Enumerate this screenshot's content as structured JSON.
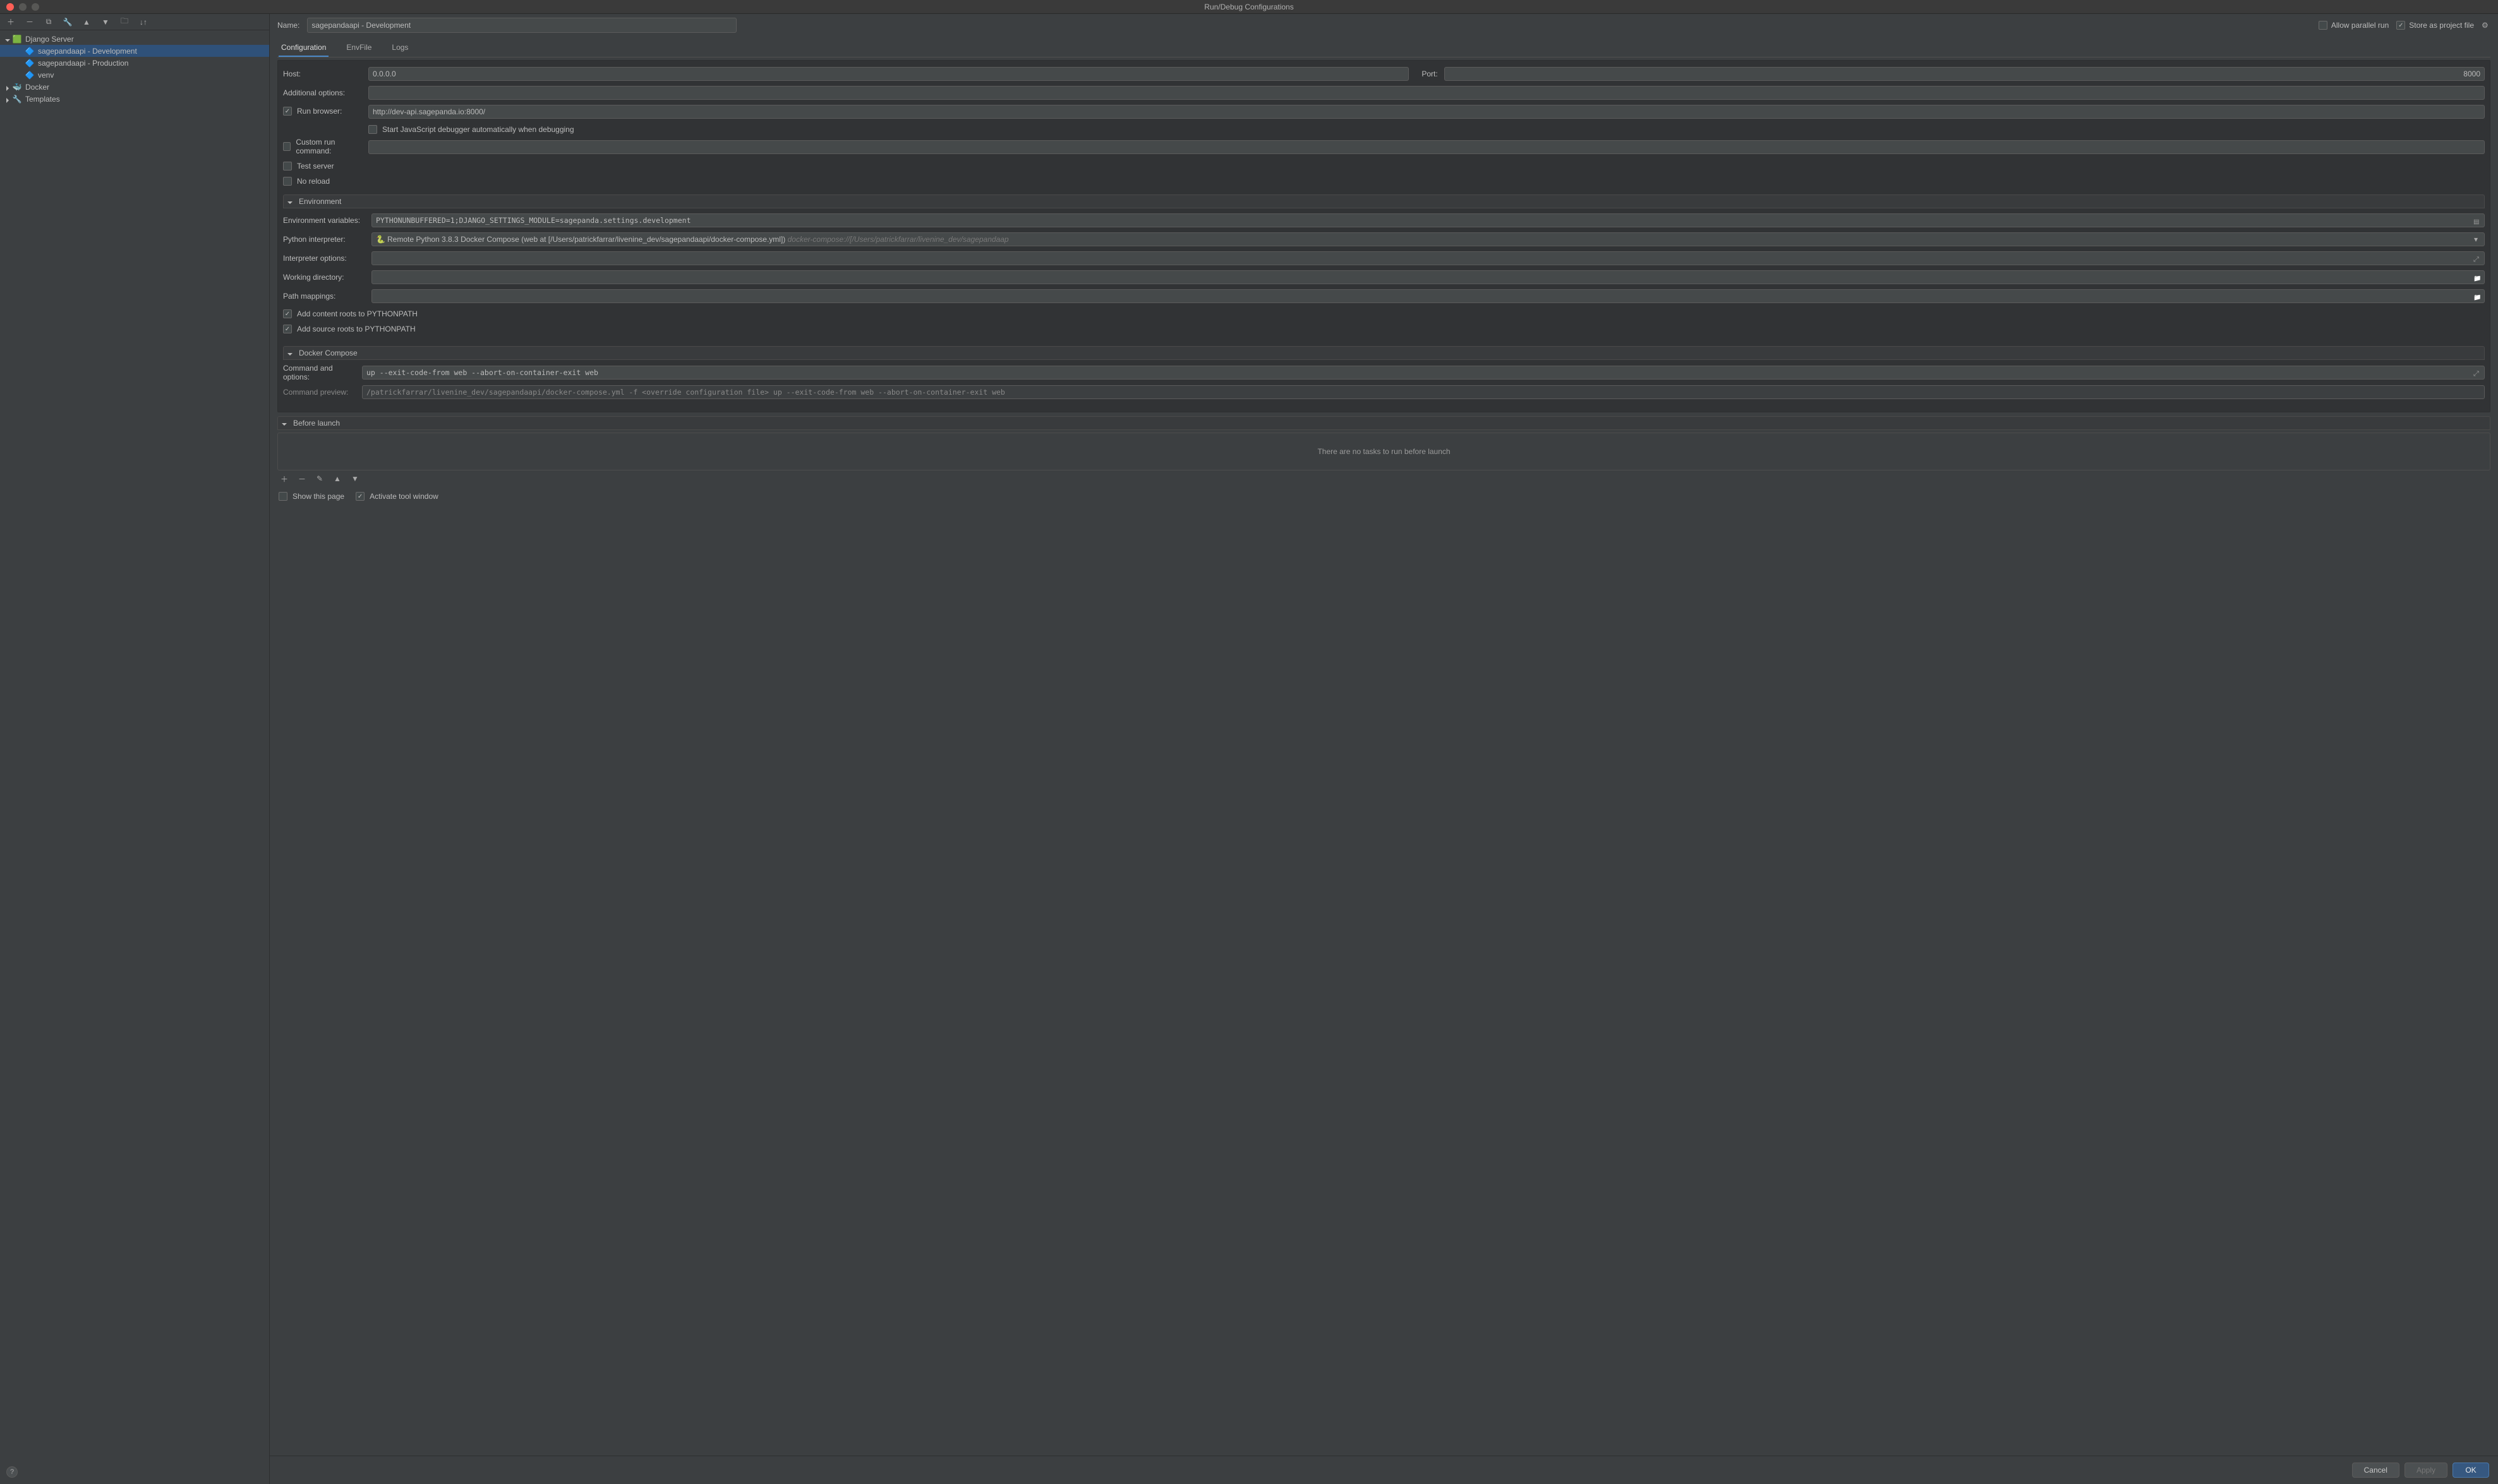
{
  "window": {
    "title": "Run/Debug Configurations"
  },
  "tree": {
    "django": {
      "label": "Django Server",
      "items": [
        {
          "label": "sagepandaapi - Development",
          "selected": true
        },
        {
          "label": "sagepandaapi - Production"
        },
        {
          "label": "venv"
        }
      ]
    },
    "docker": {
      "label": "Docker"
    },
    "templates": {
      "label": "Templates"
    }
  },
  "form": {
    "name_label": "Name:",
    "name_value": "sagepandaapi - Development",
    "allow_parallel": "Allow parallel run",
    "store_project": "Store as project file"
  },
  "tabs": {
    "configuration": "Configuration",
    "envfile": "EnvFile",
    "logs": "Logs"
  },
  "config": {
    "host_label": "Host:",
    "host_value": "0.0.0.0",
    "port_label": "Port:",
    "port_value": "8000",
    "additional_options": "Additional options:",
    "run_browser": "Run browser:",
    "run_browser_url": "http://dev-api.sagepanda.io:8000/",
    "start_js": "Start JavaScript debugger automatically when debugging",
    "custom_run": "Custom run command:",
    "test_server": "Test server",
    "no_reload": "No reload"
  },
  "env": {
    "section": "Environment",
    "env_vars_label": "Environment variables:",
    "env_vars_value": "PYTHONUNBUFFERED=1;DJANGO_SETTINGS_MODULE=sagepanda.settings.development",
    "interpreter_label": "Python interpreter:",
    "interpreter_main": "Remote Python 3.8.3 Docker Compose (web at [/Users/patrickfarrar/livenine_dev/sagepandaapi/docker-compose.yml])",
    "interpreter_suffix": " docker-compose://[/Users/patrickfarrar/livenine_dev/sagepandaap",
    "interp_options": "Interpreter options:",
    "working_dir": "Working directory:",
    "path_mappings": "Path mappings:",
    "add_content_roots": "Add content roots to PYTHONPATH",
    "add_source_roots": "Add source roots to PYTHONPATH"
  },
  "compose": {
    "section": "Docker Compose",
    "cmd_options_label": "Command and options:",
    "cmd_options_value": "up --exit-code-from web --abort-on-container-exit web",
    "cmd_preview_label": "Command preview:",
    "cmd_preview_value": "/patrickfarrar/livenine_dev/sagepandaapi/docker-compose.yml -f <override configuration file> up --exit-code-from web --abort-on-container-exit web "
  },
  "before_launch": {
    "section": "Before launch",
    "empty": "There are no tasks to run before launch"
  },
  "footer": {
    "show_page": "Show this page",
    "activate_tool": "Activate tool window",
    "cancel": "Cancel",
    "apply": "Apply",
    "ok": "OK"
  }
}
